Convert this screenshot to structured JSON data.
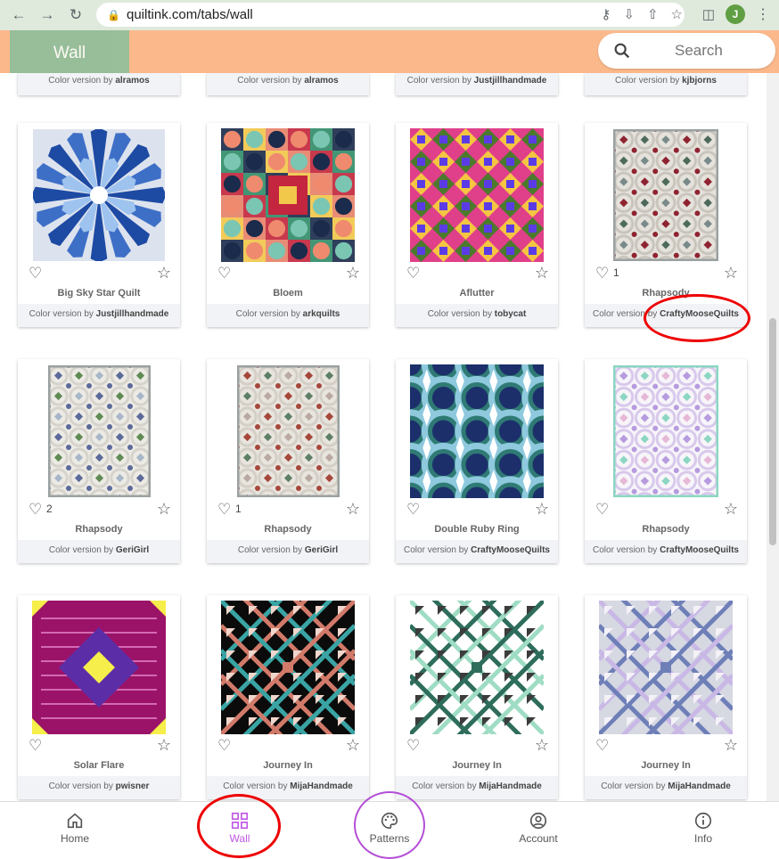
{
  "browser": {
    "url": "quiltink.com/tabs/wall",
    "profile_initial": "J"
  },
  "header": {
    "tab_label": "Wall",
    "search_placeholder": "Search"
  },
  "top_row": [
    {
      "prefix": "Color version by",
      "author": "alramos"
    },
    {
      "prefix": "Color version by",
      "author": "alramos"
    },
    {
      "prefix": "Color version by",
      "author": "Justjillhandmade"
    },
    {
      "prefix": "Color version by",
      "author": "kjbjorns"
    }
  ],
  "cards": [
    {
      "title": "Big Sky Star Quilt",
      "prefix": "Color version by",
      "author": "Justjillhandmade",
      "likes": ""
    },
    {
      "title": "Bloem",
      "prefix": "Color version by",
      "author": "arkquilts",
      "likes": ""
    },
    {
      "title": "Aflutter",
      "prefix": "Color version by",
      "author": "tobycat",
      "likes": ""
    },
    {
      "title": "Rhapsody",
      "prefix": "Color version by",
      "author": "CraftyMooseQuilts",
      "likes": "1"
    },
    {
      "title": "Rhapsody",
      "prefix": "Color version by",
      "author": "GeriGirl",
      "likes": "2"
    },
    {
      "title": "Rhapsody",
      "prefix": "Color version by",
      "author": "GeriGirl",
      "likes": "1"
    },
    {
      "title": "Double Ruby Ring",
      "prefix": "Color version by",
      "author": "CraftyMooseQuilts",
      "likes": ""
    },
    {
      "title": "Rhapsody",
      "prefix": "Color version by",
      "author": "CraftyMooseQuilts",
      "likes": ""
    },
    {
      "title": "Solar Flare",
      "prefix": "Color version by",
      "author": "pwisner",
      "likes": ""
    },
    {
      "title": "Journey In",
      "prefix": "Color version by",
      "author": "MijaHandmade",
      "likes": ""
    },
    {
      "title": "Journey In",
      "prefix": "Color version by",
      "author": "MijaHandmade",
      "likes": ""
    },
    {
      "title": "Journey In",
      "prefix": "Color version by",
      "author": "MijaHandmade",
      "likes": ""
    }
  ],
  "bottom_nav": {
    "home": "Home",
    "wall": "Wall",
    "patterns": "Patterns",
    "account": "Account",
    "info": "Info"
  },
  "colors": {
    "header_bg": "#fbb88a",
    "wall_tab_bg": "#8fbf9b",
    "active_nav": "#c159e4",
    "annotation_red": "#e00000",
    "annotation_purple": "#b44fd6"
  }
}
